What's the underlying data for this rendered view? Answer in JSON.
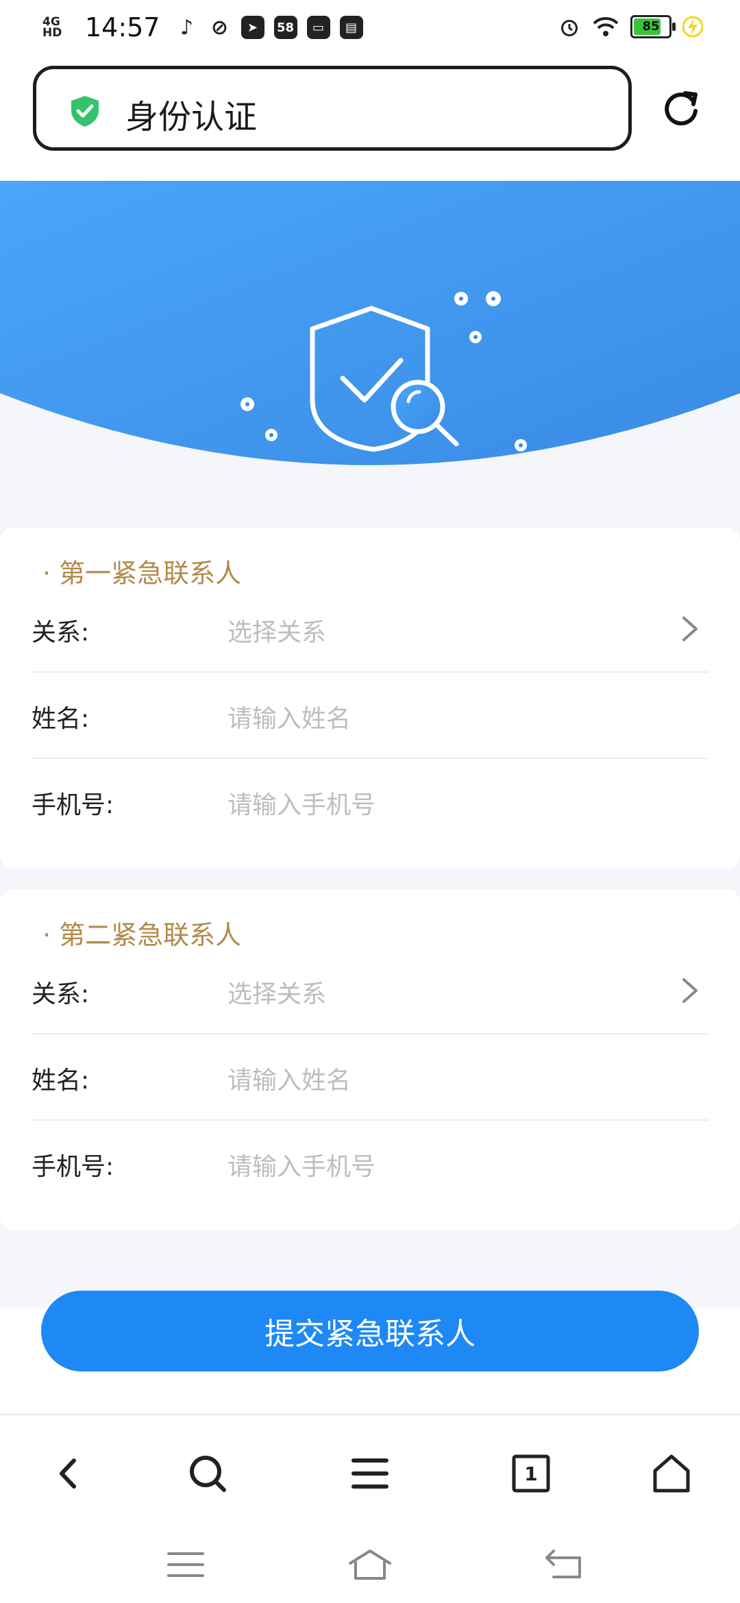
{
  "status_bar": {
    "network": "4G HD",
    "time": "14:57",
    "app_badge": "58",
    "battery": "85",
    "battery_level": 0.85
  },
  "address_bar": {
    "title": "身份认证"
  },
  "colors": {
    "accent": "#1e88f5",
    "section_title": "#b38a4a",
    "placeholder": "#bdbdbd",
    "safe_green": "#34c36b"
  },
  "contacts": [
    {
      "title": "· 第一紧急联系人",
      "relation_label": "关系:",
      "relation_placeholder": "选择关系",
      "name_label": "姓名:",
      "name_placeholder": "请输入姓名",
      "phone_label": "手机号:",
      "phone_placeholder": "请输入手机号"
    },
    {
      "title": "· 第二紧急联系人",
      "relation_label": "关系:",
      "relation_placeholder": "选择关系",
      "name_label": "姓名:",
      "name_placeholder": "请输入姓名",
      "phone_label": "手机号:",
      "phone_placeholder": "请输入手机号"
    }
  ],
  "submit_label": "提交紧急联系人",
  "toolbar": {
    "tab_count": "1"
  }
}
